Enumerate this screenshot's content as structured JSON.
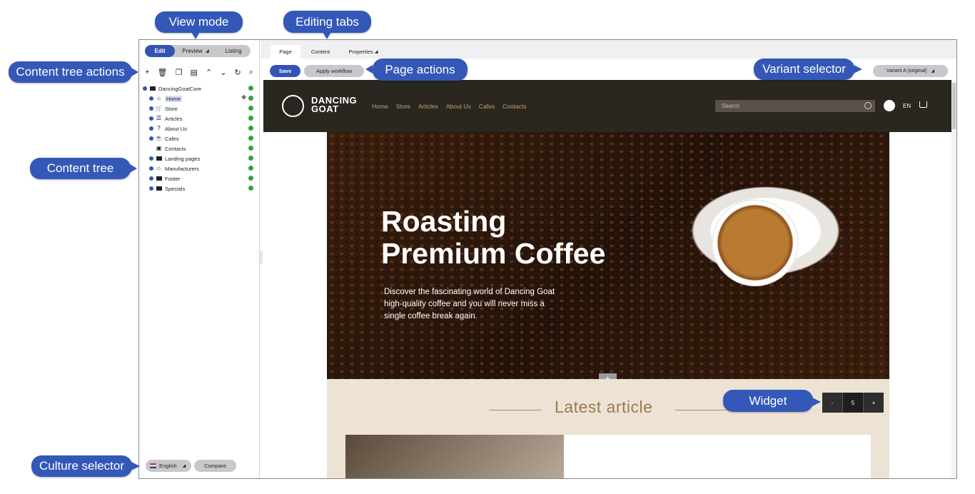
{
  "callouts": {
    "view_mode": "View mode",
    "editing_tabs": "Editing tabs",
    "content_tree_actions": "Content tree actions",
    "content_tree": "Content tree",
    "page_actions": "Page actions",
    "variant_selector": "Variant selector",
    "widget": "Widget",
    "culture_selector": "Culture selector"
  },
  "view_mode": {
    "edit": "Edit",
    "preview": "Preview",
    "listing": "Listing"
  },
  "tree_actions": [
    "+",
    "trash-icon",
    "copy-icon",
    "document-icon",
    "chevron-up-icon",
    "chevron-down-icon",
    "refresh-icon",
    "search-icon"
  ],
  "tree": {
    "root": "DancingGoatCore",
    "items": [
      {
        "label": "Home",
        "icon": "home-icon"
      },
      {
        "label": "Store",
        "icon": "cart-icon"
      },
      {
        "label": "Articles",
        "icon": "list-icon"
      },
      {
        "label": "About Us",
        "icon": "question-icon"
      },
      {
        "label": "Cafes",
        "icon": "cafe-icon"
      },
      {
        "label": "Contacts",
        "icon": "contact-icon"
      },
      {
        "label": "Landing pages",
        "icon": "folder-icon"
      },
      {
        "label": "Manufacturers",
        "icon": "factory-icon"
      },
      {
        "label": "Footer",
        "icon": "folder-icon"
      },
      {
        "label": "Specials",
        "icon": "folder-icon"
      }
    ]
  },
  "culture": {
    "language": "English",
    "compare": "Compare"
  },
  "tabs": {
    "page": "Page",
    "content": "Content",
    "properties": "Properties"
  },
  "page_actions": {
    "save": "Save",
    "apply_workflow": "Apply workflow"
  },
  "variant": "Variant A (original)",
  "site": {
    "logo_line1": "DANCING",
    "logo_line2": "GOAT",
    "nav": [
      "Home",
      "Store",
      "Articles",
      "About Us",
      "Cafes",
      "Contacts"
    ],
    "search_placeholder": "Search",
    "lang": "EN",
    "hero_title_1": "Roasting",
    "hero_title_2": "Premium Coffee",
    "hero_text": "Discover the fascinating world of Dancing Goat high-quality coffee and you will never miss a single coffee break again.",
    "latest_title": "Latest article"
  },
  "widget_control": {
    "minus": "-",
    "value": "5",
    "plus": "+"
  },
  "colors": {
    "accent": "#3454b4",
    "callout": "#3358b7",
    "site_header": "#2a2620",
    "nav_link": "#c9a36a",
    "status_ok": "#2aa83a"
  }
}
